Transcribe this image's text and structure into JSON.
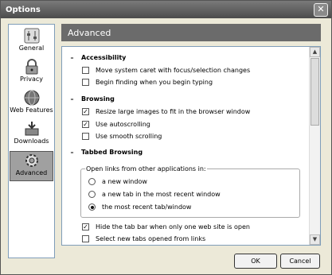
{
  "window": {
    "title": "Options"
  },
  "sidebar": {
    "items": [
      {
        "label": "General",
        "icon": "general-settings-icon",
        "active": false
      },
      {
        "label": "Privacy",
        "icon": "padlock-icon",
        "active": false
      },
      {
        "label": "Web Features",
        "icon": "globe-icon",
        "active": false
      },
      {
        "label": "Downloads",
        "icon": "download-tray-icon",
        "active": false
      },
      {
        "label": "Advanced",
        "icon": "gear-icon",
        "active": true
      }
    ]
  },
  "header": {
    "title": "Advanced"
  },
  "sections": [
    {
      "title": "Accessibility",
      "options": [
        {
          "label": "Move system caret with focus/selection changes",
          "checked": false
        },
        {
          "label": "Begin finding when you begin typing",
          "checked": false
        }
      ]
    },
    {
      "title": "Browsing",
      "options": [
        {
          "label": "Resize large images to fit in the browser window",
          "checked": true
        },
        {
          "label": "Use autoscrolling",
          "checked": true
        },
        {
          "label": "Use smooth scrolling",
          "checked": false
        }
      ]
    },
    {
      "title": "Tabbed Browsing"
    }
  ],
  "tabbed_group": {
    "label": "Open links from other applications in:",
    "radios": [
      {
        "label": "a new window",
        "selected": false
      },
      {
        "label": "a new tab in the most recent window",
        "selected": false
      },
      {
        "label": "the most recent tab/window",
        "selected": true
      }
    ]
  },
  "tabbed_options": [
    {
      "label": "Hide the tab bar when only one web site is open",
      "checked": true
    },
    {
      "label": "Select new tabs opened from links",
      "checked": false
    }
  ],
  "buttons": {
    "ok": "OK",
    "cancel": "Cancel"
  },
  "glyphs": {
    "close": "✕",
    "minus": "–",
    "check": "✓",
    "scroll_up": "▲",
    "scroll_down": "▼"
  }
}
